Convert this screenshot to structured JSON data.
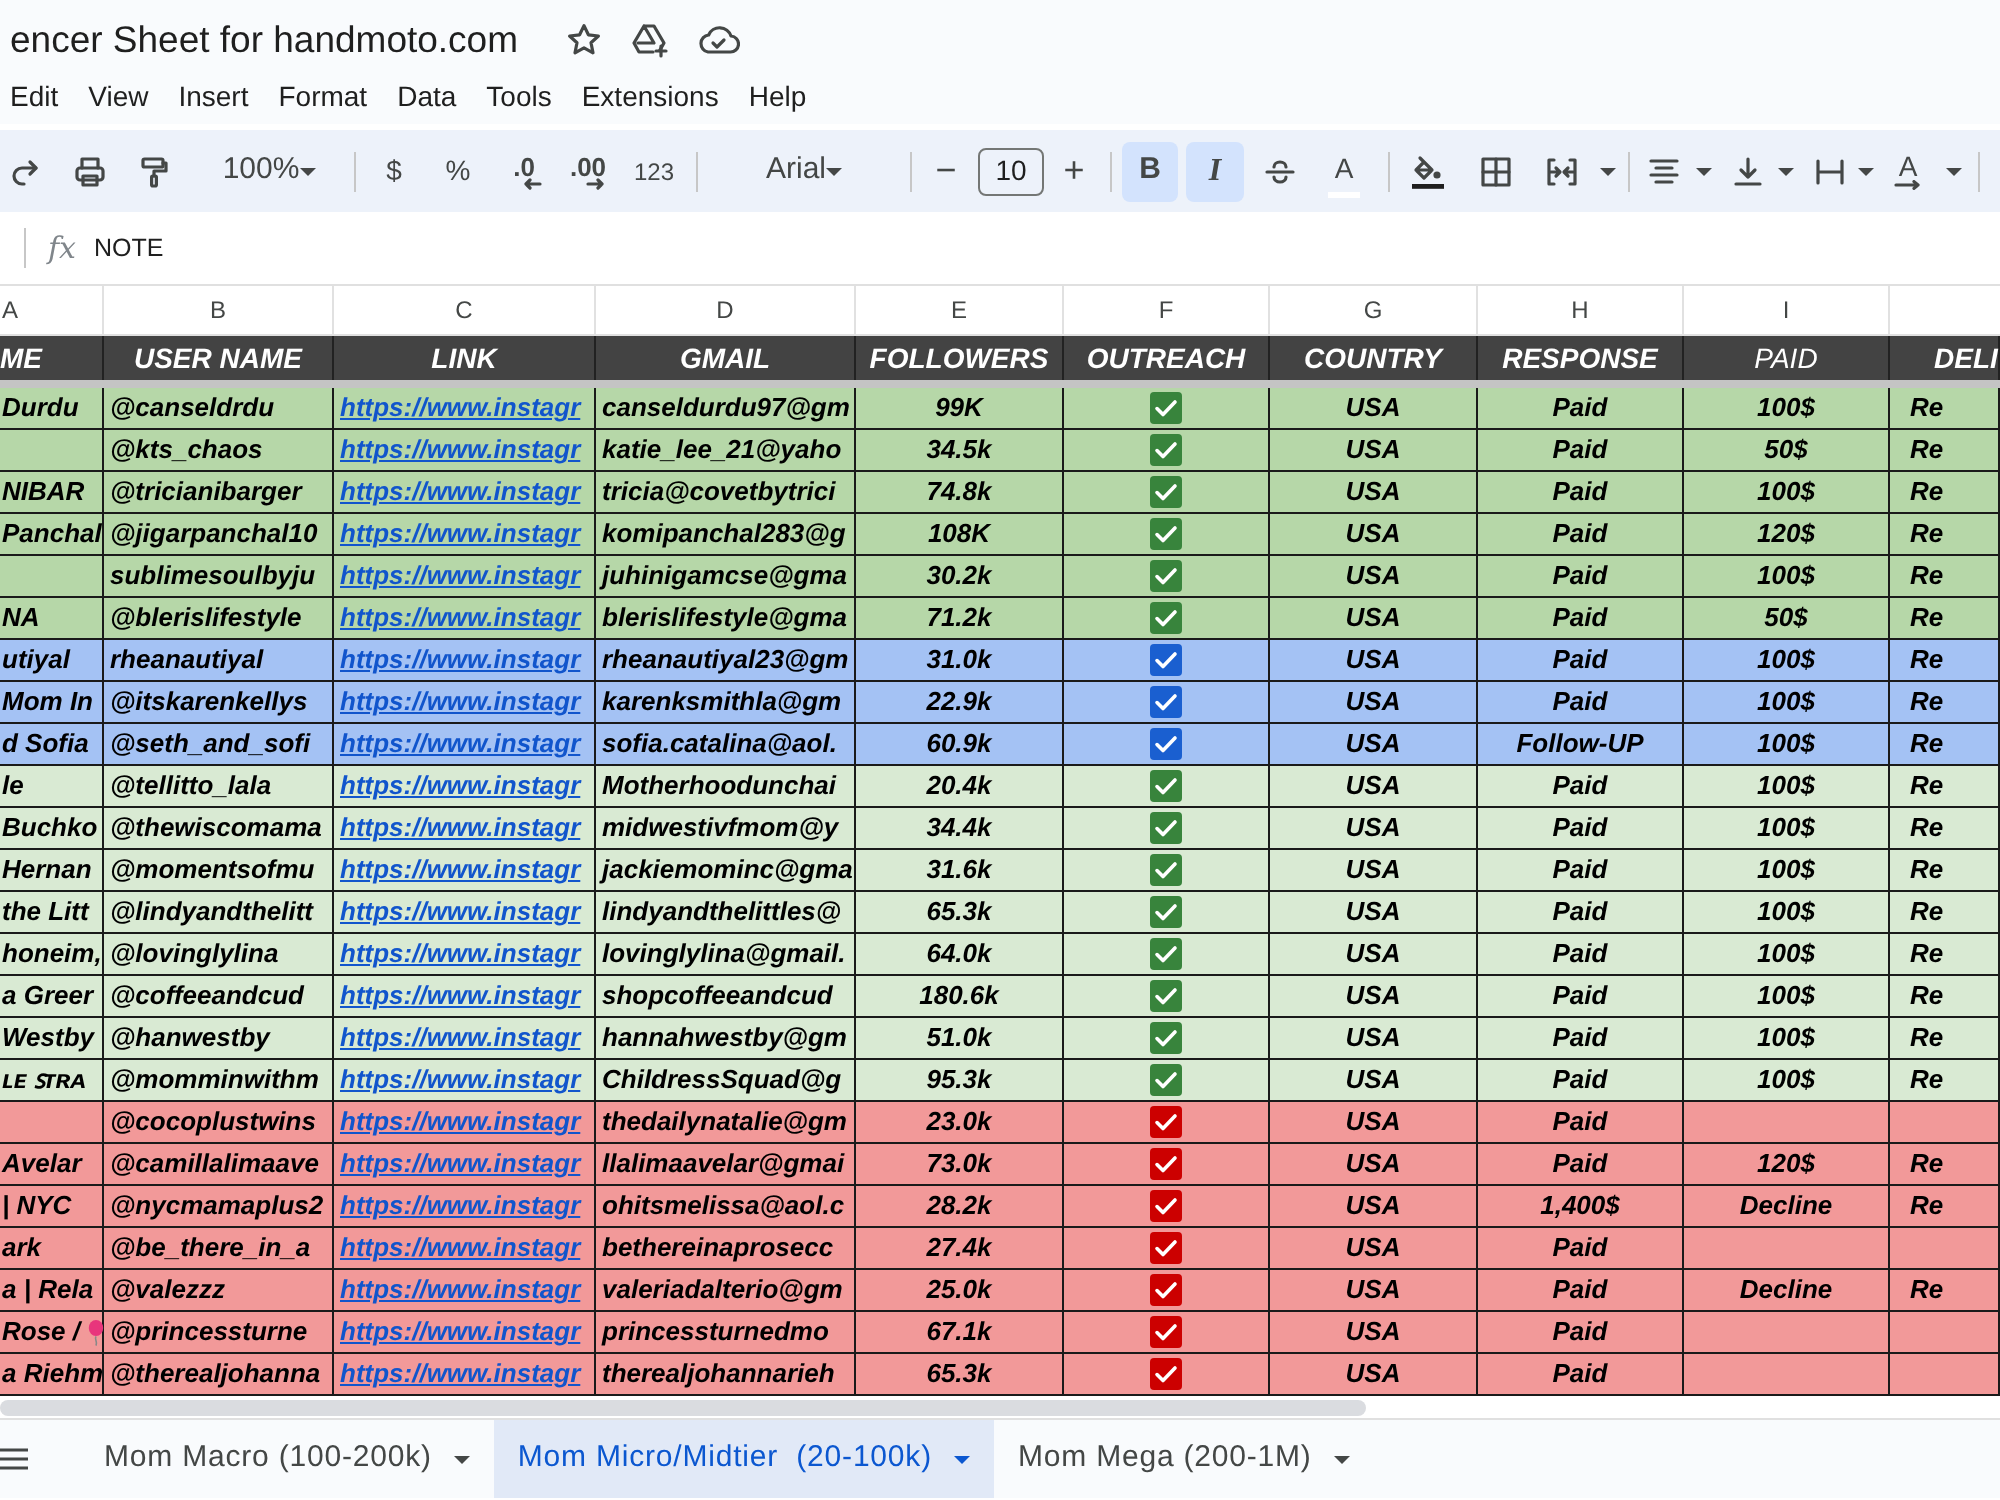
{
  "document": {
    "title": "encer Sheet for handmoto.com"
  },
  "menu": [
    "Edit",
    "View",
    "Insert",
    "Format",
    "Data",
    "Tools",
    "Extensions",
    "Help"
  ],
  "toolbar": {
    "zoom": "100%",
    "currency": "$",
    "percent": "%",
    "decrease_decimal": ".0",
    "increase_decimal": ".00",
    "number_format": "123",
    "font": "Arial",
    "font_size_minus": "−",
    "font_size": "10",
    "font_size_plus": "+",
    "bold": {
      "label": "B",
      "on": true
    },
    "italic": {
      "label": "I",
      "on": true
    },
    "text_color": "A",
    "text_rotation": "A"
  },
  "formula_bar": {
    "fx": "fx",
    "value": "NOTE"
  },
  "columns": [
    {
      "letter": "A",
      "header": "ME",
      "bold": true
    },
    {
      "letter": "B",
      "header": "USER NAME",
      "bold": true
    },
    {
      "letter": "C",
      "header": "LINK",
      "bold": true
    },
    {
      "letter": "D",
      "header": "GMAIL",
      "bold": true
    },
    {
      "letter": "E",
      "header": "FOLLOWERS",
      "bold": true
    },
    {
      "letter": "F",
      "header": "OUTREACH",
      "bold": true
    },
    {
      "letter": "G",
      "header": "COUNTRY",
      "bold": true
    },
    {
      "letter": "H",
      "header": "RESPONSE",
      "bold": true
    },
    {
      "letter": "I",
      "header": "PAID",
      "bold": false
    },
    {
      "header": "DELI",
      "bold": true
    }
  ],
  "rows": [
    {
      "color": "#b6d7a8",
      "column_1": "Durdu",
      "user_name": "@canseldrdu",
      "link": "https://www.instagr",
      "gmail": "canseldurdu97@gm",
      "followers": "99K",
      "outreach": {
        "checked": true,
        "color": "#38843c"
      },
      "country": "USA",
      "response": "Paid",
      "paid": "100$",
      "column_10": "Re"
    },
    {
      "color": "#b6d7a8",
      "user_name": "@kts_chaos",
      "link": "https://www.instagr",
      "gmail": "katie_lee_21@yaho",
      "followers": "34.5k",
      "outreach": {
        "checked": true,
        "color": "#38843c"
      },
      "country": "USA",
      "response": "Paid",
      "paid": "50$",
      "column_10": "Re"
    },
    {
      "color": "#b6d7a8",
      "column_1": "NIBAR",
      "user_name": "@tricianibarger",
      "link": "https://www.instagr",
      "gmail": "tricia@covetbytrici",
      "followers": "74.8k",
      "outreach": {
        "checked": true,
        "color": "#38843c"
      },
      "country": "USA",
      "response": "Paid",
      "paid": "100$",
      "column_10": "Re"
    },
    {
      "color": "#b6d7a8",
      "column_1": "Panchal",
      "user_name": "@jigarpanchal10",
      "link": "https://www.instagr",
      "gmail": "komipanchal283@g",
      "followers": "108K",
      "outreach": {
        "checked": true,
        "color": "#38843c"
      },
      "country": "USA",
      "response": "Paid",
      "paid": "120$",
      "column_10": "Re"
    },
    {
      "color": "#b6d7a8",
      "user_name": "sublimesoulbyju",
      "link": "https://www.instagr",
      "gmail": "juhinigamcse@gma",
      "followers": "30.2k",
      "outreach": {
        "checked": true,
        "color": "#38843c"
      },
      "country": "USA",
      "response": "Paid",
      "paid": "100$",
      "column_10": "Re"
    },
    {
      "color": "#b6d7a8",
      "column_1": "NA",
      "user_name": "@blerislifestyle",
      "link": "https://www.instagr",
      "gmail": "blerislifestyle@gma",
      "followers": "71.2k",
      "outreach": {
        "checked": true,
        "color": "#38843c"
      },
      "country": "USA",
      "response": "Paid",
      "paid": "50$",
      "column_10": "Re"
    },
    {
      "color": "#a4c2f4",
      "column_1": "utiyal",
      "user_name": "rheanautiyal",
      "link": "https://www.instagr",
      "gmail": "rheanautiyal23@gm",
      "followers": "31.0k",
      "outreach": {
        "checked": true,
        "color": "#1a5fd0"
      },
      "country": "USA",
      "response": "Paid",
      "paid": "100$",
      "column_10": "Re"
    },
    {
      "color": "#a4c2f4",
      "column_1": "Mom In",
      "user_name": "@itskarenkellys",
      "link": "https://www.instagr",
      "gmail": "karenksmithla@gm",
      "followers": "22.9k",
      "outreach": {
        "checked": true,
        "color": "#1a5fd0"
      },
      "country": "USA",
      "response": "Paid",
      "paid": "100$",
      "column_10": "Re"
    },
    {
      "color": "#a4c2f4",
      "column_1": "d Sofia",
      "user_name": "@seth_and_sofi",
      "link": "https://www.instagr",
      "gmail": "sofia.catalina@aol.",
      "followers": "60.9k",
      "outreach": {
        "checked": true,
        "color": "#1a5fd0"
      },
      "country": "USA",
      "response": "Follow-UP",
      "paid": "100$",
      "column_10": "Re"
    },
    {
      "color": "#d9ead3",
      "column_1": "le",
      "user_name": "@tellitto_lala",
      "link": "https://www.instagr",
      "gmail": "Motherhoodunchai",
      "followers": "20.4k",
      "outreach": {
        "checked": true,
        "color": "#38843c"
      },
      "country": "USA",
      "response": "Paid",
      "paid": "100$",
      "column_10": "Re"
    },
    {
      "color": "#d9ead3",
      "column_1": "Buchko",
      "user_name": "@thewiscomama",
      "link": "https://www.instagr",
      "gmail": "midwestivfmom@y",
      "followers": "34.4k",
      "outreach": {
        "checked": true,
        "color": "#38843c"
      },
      "country": "USA",
      "response": "Paid",
      "paid": "100$",
      "column_10": "Re"
    },
    {
      "color": "#d9ead3",
      "column_1": "Hernan",
      "user_name": "@momentsofmu",
      "link": "https://www.instagr",
      "gmail": "jackiemominc@gma",
      "followers": "31.6k",
      "outreach": {
        "checked": true,
        "color": "#38843c"
      },
      "country": "USA",
      "response": "Paid",
      "paid": "100$",
      "column_10": "Re"
    },
    {
      "color": "#d9ead3",
      "column_1": "the Litt",
      "user_name": "@lindyandthelitt",
      "link": "https://www.instagr",
      "gmail": "lindyandthelittles@",
      "followers": "65.3k",
      "outreach": {
        "checked": true,
        "color": "#38843c"
      },
      "country": "USA",
      "response": "Paid",
      "paid": "100$",
      "column_10": "Re"
    },
    {
      "color": "#d9ead3",
      "column_1": "honeim,",
      "user_name": "@lovinglylina",
      "link": "https://www.instagr",
      "gmail": "lovinglylina@gmail.",
      "followers": "64.0k",
      "outreach": {
        "checked": true,
        "color": "#38843c"
      },
      "country": "USA",
      "response": "Paid",
      "paid": "100$",
      "column_10": "Re"
    },
    {
      "color": "#d9ead3",
      "column_1": "a Greer",
      "user_name": "@coffeeandcud",
      "link": "https://www.instagr",
      "gmail": "shopcoffeeandcud",
      "followers": "180.6k",
      "outreach": {
        "checked": true,
        "color": "#38843c"
      },
      "country": "USA",
      "response": "Paid",
      "paid": "100$",
      "column_10": "Re"
    },
    {
      "color": "#d9ead3",
      "column_1": "Westby",
      "user_name": "@hanwestby",
      "link": "https://www.instagr",
      "gmail": "hannahwestby@gm",
      "followers": "51.0k",
      "outreach": {
        "checked": true,
        "color": "#38843c"
      },
      "country": "USA",
      "response": "Paid",
      "paid": "100$",
      "column_10": "Re"
    },
    {
      "color": "#d9ead3",
      "column_1": "ʟᴇ ꜱᴛʀᴀ",
      "user_name": "@momminwithm",
      "link": "https://www.instagr",
      "gmail": "ChildressSquad@g",
      "followers": "95.3k",
      "outreach": {
        "checked": true,
        "color": "#38843c"
      },
      "country": "USA",
      "response": "Paid",
      "paid": "100$",
      "column_10": "Re"
    },
    {
      "color": "#f29999",
      "user_name": "@cocoplustwins",
      "link": "https://www.instagr",
      "gmail": "thedailynatalie@gm",
      "followers": "23.0k",
      "outreach": {
        "checked": true,
        "color": "#cc0000"
      },
      "country": "USA",
      "response": "Paid"
    },
    {
      "color": "#f29999",
      "column_1": "Avelar",
      "user_name": "@camillalimaave",
      "link": "https://www.instagr",
      "gmail": "llalimaavelar@gmai",
      "followers": "73.0k",
      "outreach": {
        "checked": true,
        "color": "#cc0000"
      },
      "country": "USA",
      "response": "Paid",
      "paid": "120$",
      "column_10": "Re"
    },
    {
      "color": "#f29999",
      "column_1": "| NYC",
      "user_name": "@nycmamaplus2",
      "link": "https://www.instagr",
      "gmail": "ohitsmelissa@aol.c",
      "followers": "28.2k",
      "outreach": {
        "checked": true,
        "color": "#cc0000"
      },
      "country": "USA",
      "response": "1,400$",
      "paid": "Decline",
      "column_10": "Re"
    },
    {
      "color": "#f29999",
      "column_1": "ark",
      "user_name": "@be_there_in_a",
      "link": "https://www.instagr",
      "gmail": "bethereinaprosecc",
      "followers": "27.4k",
      "outreach": {
        "checked": true,
        "color": "#cc0000"
      },
      "country": "USA",
      "response": "Paid"
    },
    {
      "color": "#f29999",
      "column_1": "a | Rela",
      "user_name": "@valezzz",
      "link": "https://www.instagr",
      "gmail": "valeriadalterio@gm",
      "followers": "25.0k",
      "outreach": {
        "checked": true,
        "color": "#cc0000"
      },
      "country": "USA",
      "response": "Paid",
      "paid": "Decline",
      "column_10": "Re"
    },
    {
      "color": "#f29999",
      "column_1": "Rose /",
      "marker": true,
      "user_name": "@princessturne",
      "link": "https://www.instagr",
      "gmail": "princessturnedmo",
      "followers": "67.1k",
      "outreach": {
        "checked": true,
        "color": "#cc0000"
      },
      "country": "USA",
      "response": "Paid"
    },
    {
      "color": "#f29999",
      "column_1": "a Riehm",
      "user_name": "@therealjohanna",
      "link": "https://www.instagr",
      "gmail": "therealjohannarieh",
      "followers": "65.3k",
      "outreach": {
        "checked": true,
        "color": "#cc0000"
      },
      "country": "USA",
      "response": "Paid"
    }
  ],
  "sheet_tabs": [
    {
      "label": "Mom Macro (100-200k)",
      "selected": false
    },
    {
      "label": "Mom Micro/Midtier  (20-100k)",
      "selected": true
    },
    {
      "label": "Mom Mega (200-1M)",
      "selected": false
    }
  ]
}
